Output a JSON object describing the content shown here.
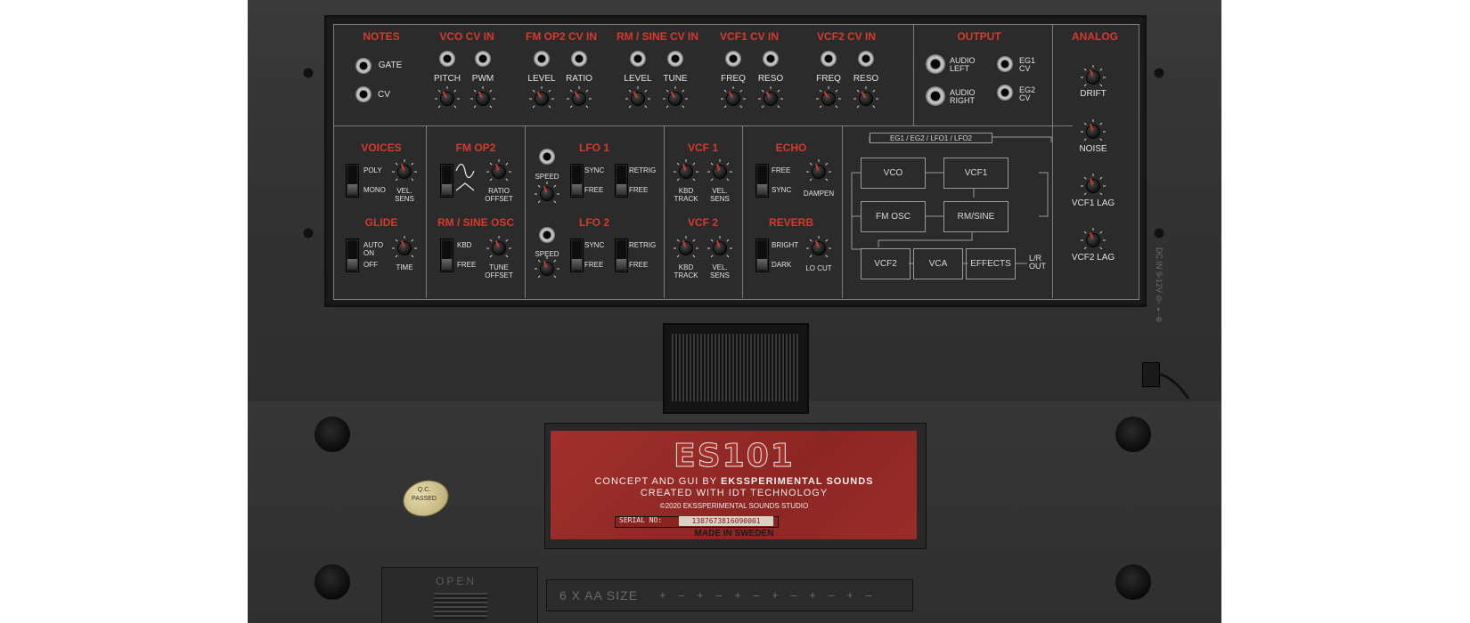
{
  "app": {
    "name": "ES101"
  },
  "top_row": {
    "notes": {
      "title": "NOTES",
      "gate": "GATE",
      "cv": "CV"
    },
    "vco_cv": {
      "title": "VCO CV IN",
      "pitch": "PITCH",
      "pwm": "PWM"
    },
    "fm_cv": {
      "title": "FM OP2 CV IN",
      "level": "LEVEL",
      "ratio": "RATIO"
    },
    "rm_cv": {
      "title": "RM / SINE CV IN",
      "level": "LEVEL",
      "tune": "TUNE"
    },
    "vcf1_cv": {
      "title": "VCF1 CV IN",
      "freq": "FREQ",
      "reso": "RESO"
    },
    "vcf2_cv": {
      "title": "VCF2 CV IN",
      "freq": "FREQ",
      "reso": "RESO"
    },
    "output": {
      "title": "OUTPUT",
      "audio_left": [
        "AUDIO",
        "LEFT"
      ],
      "audio_right": [
        "AUDIO",
        "RIGHT"
      ],
      "eg1": [
        "EG1",
        "CV"
      ],
      "eg2": [
        "EG2",
        "CV"
      ]
    }
  },
  "analog": {
    "title": "ANALOG",
    "drift": "DRIFT",
    "noise": "NOISE",
    "vcf1_lag": "VCF1 LAG",
    "vcf2_lag": "VCF2 LAG"
  },
  "voices": {
    "title": "VOICES",
    "poly": "POLY",
    "mono": "MONO",
    "vel": [
      "VEL.",
      "SENS"
    ]
  },
  "glide": {
    "title": "GLIDE",
    "auto_on": [
      "AUTO",
      "ON"
    ],
    "off": "OFF",
    "time": "TIME"
  },
  "fm_op2": {
    "title": "FM OP2",
    "ratio_offset": [
      "RATIO",
      "OFFSET"
    ]
  },
  "rm_sine_osc": {
    "title": "RM / SINE OSC",
    "kbd": "KBD",
    "free": "FREE",
    "tune_offset": [
      "TUNE",
      "OFFSET"
    ]
  },
  "lfo1": {
    "title": "LFO 1",
    "speed": "SPEED",
    "sync": "SYNC",
    "free": "FREE",
    "retrig": "RETRIG",
    "free2": "FREE"
  },
  "lfo2": {
    "title": "LFO 2",
    "speed": "SPEED",
    "sync": "SYNC",
    "free": "FREE",
    "retrig": "RETRIG",
    "free2": "FREE"
  },
  "vcf1": {
    "title": "VCF 1",
    "kbd_track": [
      "KBD",
      "TRACK"
    ],
    "vel_sens": [
      "VEL.",
      "SENS"
    ]
  },
  "vcf2": {
    "title": "VCF 2",
    "kbd_track": [
      "KBD",
      "TRACK"
    ],
    "vel_sens": [
      "VEL.",
      "SENS"
    ]
  },
  "echo": {
    "title": "ECHO",
    "free": "FREE",
    "sync": "SYNC",
    "dampen": "DAMPEN"
  },
  "reverb": {
    "title": "REVERB",
    "bright": "BRIGHT",
    "dark": "DARK",
    "lo_cut": "LO CUT"
  },
  "routing": {
    "mod_label": "EG1 / EG2 / LFO1 / LFO2",
    "vco": "VCO",
    "vcf1": "VCF1",
    "fm_osc": "FM OSC",
    "rm_sine": "RM/SINE",
    "vcf2": "VCF2",
    "vca": "VCA",
    "effects": "EFFECTS",
    "out": [
      "L/R",
      "OUT"
    ]
  },
  "side_text": "DC IN 9-12V ⊝-◐-⊕",
  "label": {
    "logo": "ES101",
    "line1_prefix": "CONCEPT AND GUI BY ",
    "line1_bold": "EKSSPERIMENTAL SOUNDS",
    "line2": "CREATED WITH IDT TECHNOLOGY",
    "copyright": "©2020 EKSSPERIMENTAL SOUNDS STUDIO",
    "serial_label": "SERIAL NO:",
    "serial_value": "1387673816090001",
    "made_in": "MADE IN SWEDEN"
  },
  "sticker": {
    "line1": "Q.C.",
    "line2": "PASSED"
  },
  "battery_door": {
    "open": "OPEN"
  },
  "battery": {
    "text": "6 X AA SIZE",
    "polarity": "+ – + – + – + – + – + –"
  },
  "colors": {
    "accent_red": "#d53a2e",
    "panel_bg": "#2b2b2b",
    "label_red": "#9b2c28"
  }
}
